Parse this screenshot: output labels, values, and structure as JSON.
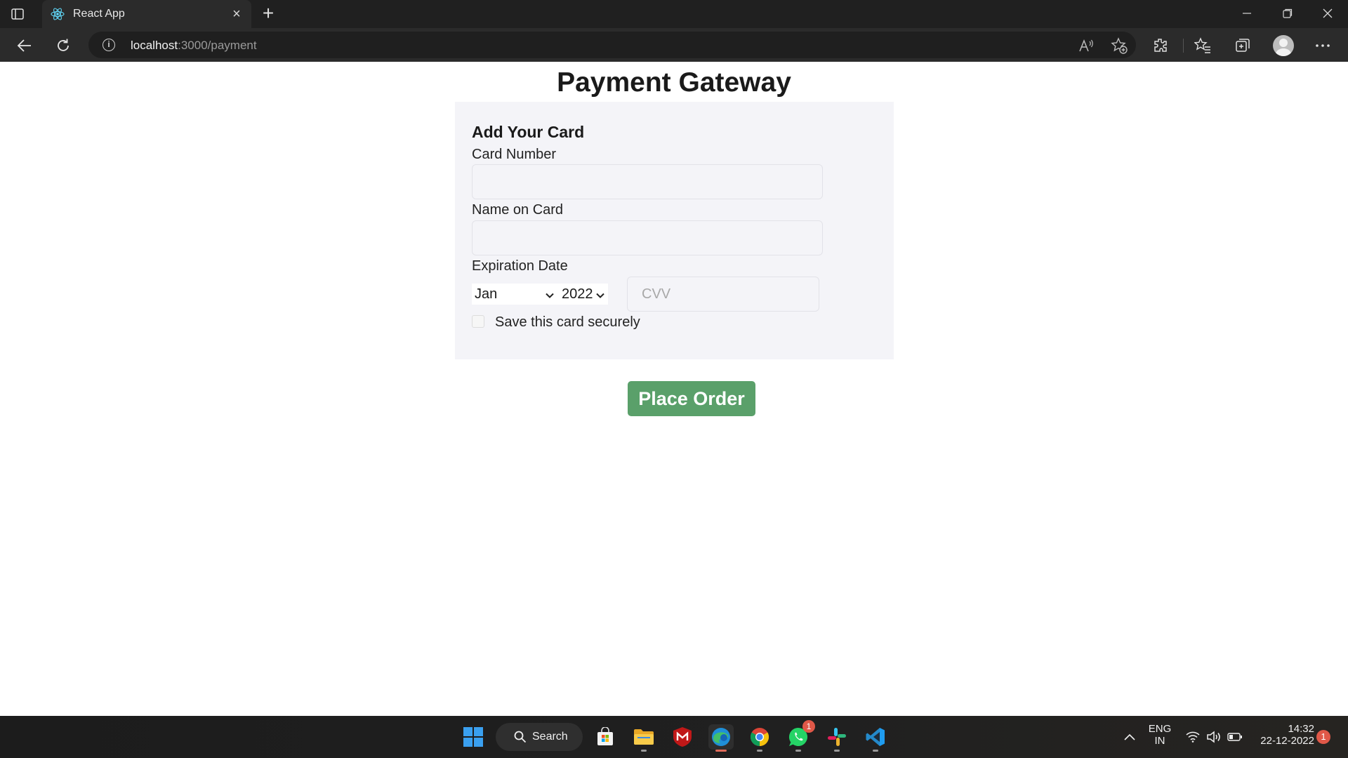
{
  "browser": {
    "tab_title": "React App",
    "new_tab_symbol": "+",
    "close_symbol": "×",
    "url_host": "localhost",
    "url_path": ":3000/payment",
    "info_symbol": "i"
  },
  "page": {
    "title": "Payment Gateway",
    "panel_heading": "Add Your Card",
    "card_number_label": "Card Number",
    "name_on_card_label": "Name on Card",
    "expiration_label": "Expiration Date",
    "month_value": "Jan",
    "year_value": "2022",
    "cvv_placeholder": "CVV",
    "save_card_label": "Save this card securely",
    "save_card_checked": false,
    "place_order_label": "Place Order"
  },
  "colors": {
    "button_green": "#5aa06a",
    "panel_bg": "#f4f4f8",
    "chrome_dark": "#202020",
    "badge_red": "#e05848"
  },
  "taskbar": {
    "search_label": "Search",
    "whatsapp_badge": "1",
    "language_line1": "ENG",
    "language_line2": "IN",
    "time": "14:32",
    "date": "22-12-2022",
    "notification_count": "1",
    "apps": [
      "windows-start-icon",
      "search-icon",
      "microsoft-store-icon",
      "file-explorer-icon",
      "mcafee-icon",
      "edge-icon",
      "chrome-icon",
      "whatsapp-icon",
      "slack-icon",
      "vscode-icon"
    ]
  }
}
